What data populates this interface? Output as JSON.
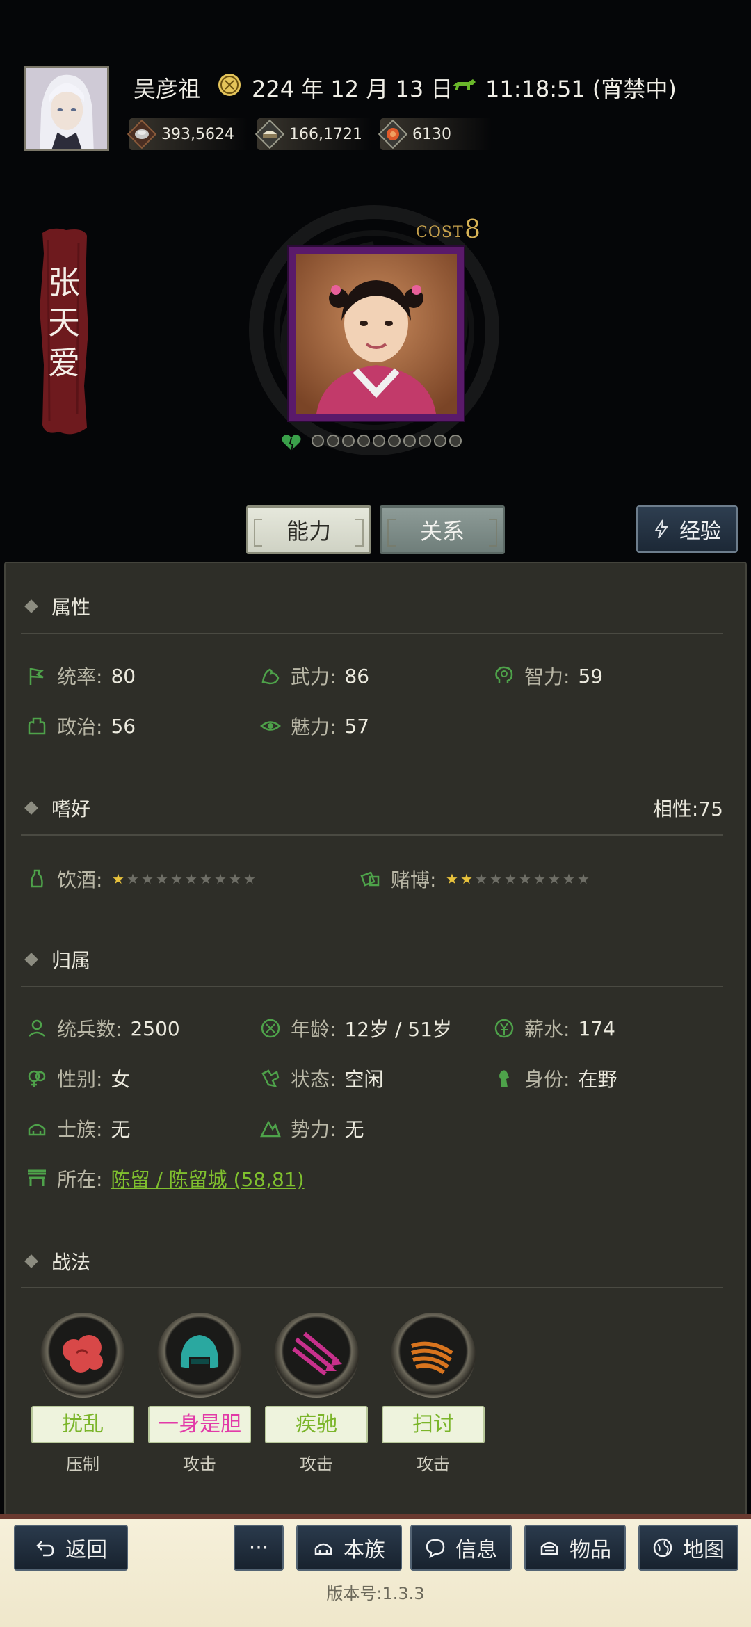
{
  "header": {
    "player_name": "吴彦祖",
    "date": "224 年 12 月 13 日",
    "time": "11:18:51 (宵禁中)",
    "resources": [
      {
        "name": "silver",
        "value": "393,5624"
      },
      {
        "name": "food",
        "value": "166,1721"
      },
      {
        "name": "gold",
        "value": "6130"
      }
    ]
  },
  "character": {
    "name_chars": [
      "张",
      "天",
      "爱"
    ],
    "cost_label": "COST",
    "cost_value": "8",
    "loyalty_filled": 0,
    "loyalty_total": 10
  },
  "tabs": {
    "ability": "能力",
    "relation": "关系",
    "exp": "经验"
  },
  "attributes": {
    "title": "属性",
    "items": [
      {
        "label": "统率:",
        "value": "80",
        "icon": "flag-icon"
      },
      {
        "label": "武力:",
        "value": "86",
        "icon": "muscle-icon"
      },
      {
        "label": "智力:",
        "value": "59",
        "icon": "brain-icon"
      },
      {
        "label": "政治:",
        "value": "56",
        "icon": "politics-icon"
      },
      {
        "label": "魅力:",
        "value": "57",
        "icon": "eye-icon"
      }
    ]
  },
  "hobbies": {
    "title": "嗜好",
    "affinity": "相性:75",
    "drink_label": "饮酒:",
    "drink_stars": 1,
    "gamble_label": "赌博:",
    "gamble_stars": 2,
    "max_stars": 10
  },
  "belonging": {
    "title": "归属",
    "items": [
      {
        "label": "统兵数:",
        "value": "2500"
      },
      {
        "label": "年龄:",
        "value": "12岁 / 51岁"
      },
      {
        "label": "薪水:",
        "value": "174"
      },
      {
        "label": "性别:",
        "value": "女"
      },
      {
        "label": "状态:",
        "value": "空闲"
      },
      {
        "label": "身份:",
        "value": "在野"
      },
      {
        "label": "士族:",
        "value": "无"
      },
      {
        "label": "势力:",
        "value": "无"
      }
    ],
    "location_label": "所在:",
    "location_value": "陈留 / 陈留城 (58,81)"
  },
  "tactics": {
    "title": "战法",
    "items": [
      {
        "name": "扰乱",
        "type": "压制",
        "color": "#d84848"
      },
      {
        "name": "一身是胆",
        "type": "攻击",
        "color": "#2aa8a0"
      },
      {
        "name": "疾驰",
        "type": "攻击",
        "color": "#c8308c"
      },
      {
        "name": "扫讨",
        "type": "攻击",
        "color": "#d8741e"
      }
    ]
  },
  "bottom_nav": {
    "back": "返回",
    "more": "···",
    "clan": "本族",
    "info": "信息",
    "items": "物品",
    "map": "地图"
  },
  "version": "版本号:1.3.3"
}
